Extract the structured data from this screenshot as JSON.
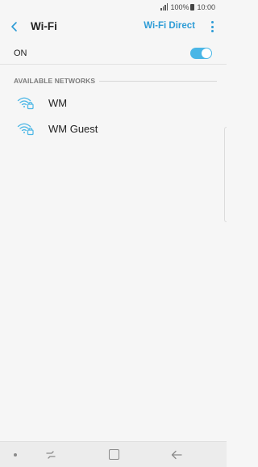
{
  "status": {
    "battery": "100%",
    "time": "10:00"
  },
  "header": {
    "title": "Wi-Fi",
    "wifi_direct": "Wi-Fi Direct"
  },
  "toggle": {
    "label": "ON",
    "on": true
  },
  "networks_section": {
    "title": "AVAILABLE NETWORKS"
  },
  "networks": [
    {
      "name": "WM",
      "icon": "wifi-lock-icon"
    },
    {
      "name": "WM Guest",
      "icon": "wifi-lock-icon"
    }
  ],
  "colors": {
    "accent": "#2d9cd6",
    "toggle": "#4ab6e6",
    "background": "#f6f6f6"
  }
}
